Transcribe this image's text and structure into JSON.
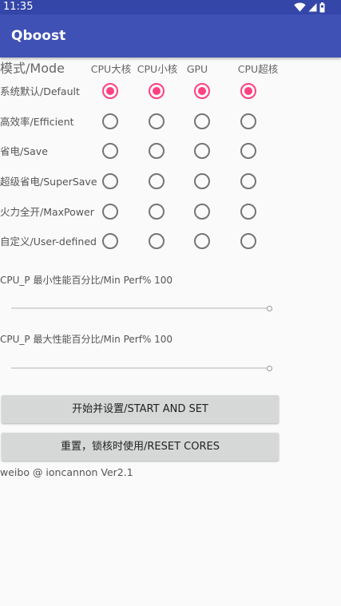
{
  "status_bar": {
    "time": "11:35",
    "icons": [
      "wifi-icon",
      "cellular-signal-icon",
      "battery-icon"
    ]
  },
  "app_bar": {
    "title": "Qboost",
    "color": "#3f51b5"
  },
  "mode_table": {
    "header": "模式/Mode",
    "columns": [
      "CPU大核",
      "CPU小核",
      "GPU",
      "CPU超核"
    ],
    "rows": [
      {
        "label": "系统默认/Default",
        "selected": [
          true,
          true,
          true,
          true
        ]
      },
      {
        "label": "高效率/Efficient",
        "selected": [
          false,
          false,
          false,
          false
        ]
      },
      {
        "label": "省电/Save",
        "selected": [
          false,
          false,
          false,
          false
        ]
      },
      {
        "label": "超级省电/SuperSave",
        "selected": [
          false,
          false,
          false,
          false
        ]
      },
      {
        "label": "火力全开/MaxPower",
        "selected": [
          false,
          false,
          false,
          false
        ]
      },
      {
        "label": "自定义/User-defined",
        "selected": [
          false,
          false,
          false,
          false
        ]
      }
    ],
    "accent_color": "#ff4081"
  },
  "min_perf": {
    "label": "CPU_P 最小性能百分比/Min Perf% 100",
    "value_percent": 100
  },
  "max_perf": {
    "label": "CPU_P 最大性能百分比/Min Perf% 100",
    "value_percent": 100
  },
  "buttons": {
    "start": "开始并设置/START AND SET",
    "reset": "重置，锁核时使用/RESET CORES"
  },
  "footer": "weibo @ ioncannon Ver2.1"
}
